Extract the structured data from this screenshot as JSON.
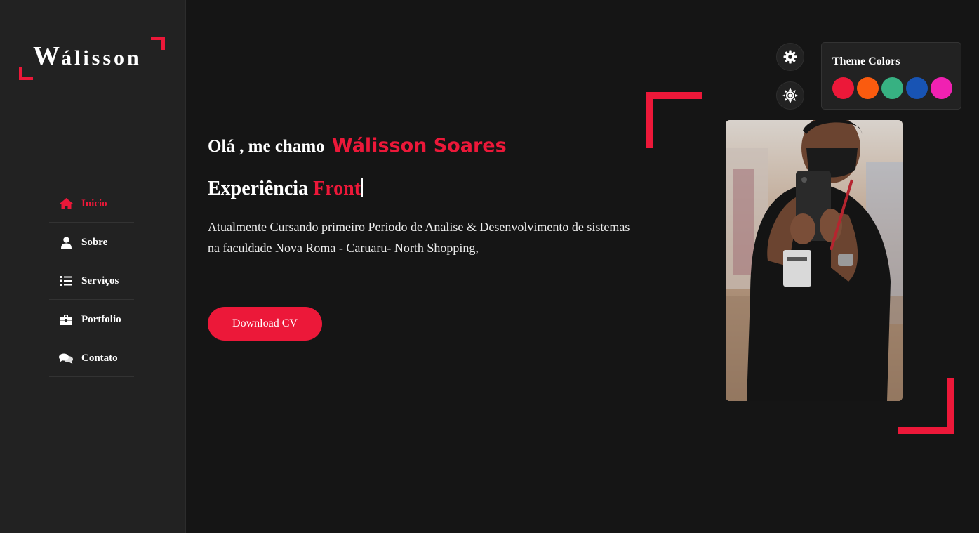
{
  "logo": {
    "first_letter": "W",
    "rest": "álisson"
  },
  "nav": [
    {
      "label": "Inicio",
      "icon": "home-icon",
      "active": true
    },
    {
      "label": "Sobre",
      "icon": "user-icon",
      "active": false
    },
    {
      "label": "Serviços",
      "icon": "list-icon",
      "active": false
    },
    {
      "label": "Portfolio",
      "icon": "briefcase-icon",
      "active": false
    },
    {
      "label": "Contato",
      "icon": "comments-icon",
      "active": false
    }
  ],
  "hero": {
    "greeting": "Olá , me chamo",
    "name": "Wálisson Soares",
    "experience_label": "Experiência",
    "typed_text": "Front",
    "description": "Atualmente Cursando primeiro Periodo de Analise & Desenvolvimento de sistemas na faculdade Nova Roma - Caruaru- North Shopping,",
    "download_label": "Download CV"
  },
  "switcher": {
    "title": "Theme Colors",
    "gear_icon": "gear-icon",
    "mode_icon": "sun-icon",
    "colors": [
      "#ec1839",
      "#fa5b0f",
      "#37b182",
      "#1854b4",
      "#f021b2"
    ]
  },
  "accent_color": "#ec1839"
}
